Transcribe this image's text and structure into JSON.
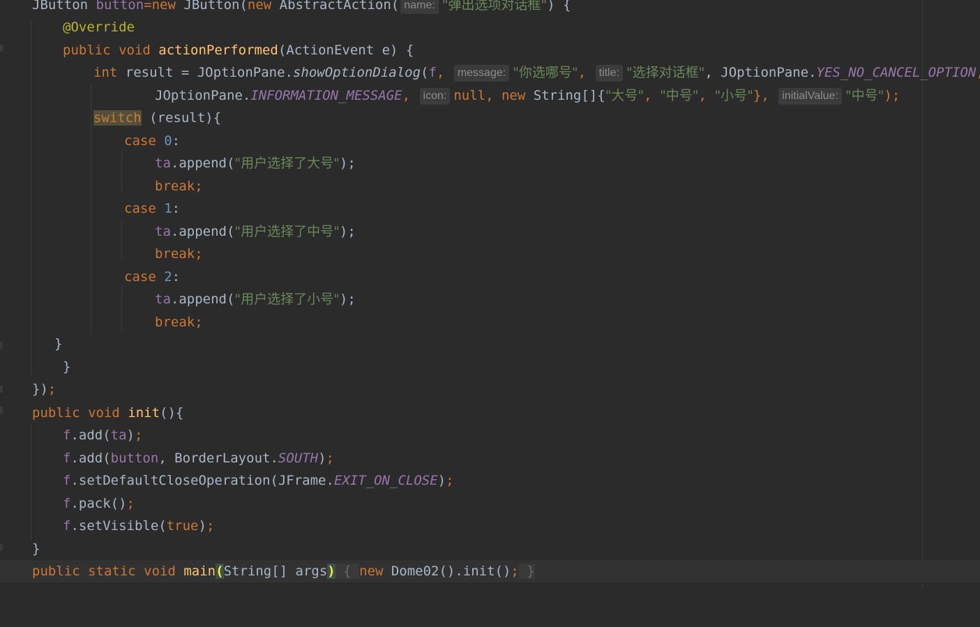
{
  "lines": [
    {
      "t1": "JButton ",
      "t2": "button",
      "t3": "=",
      "t4": "new ",
      "t5": "JButton(",
      "t6": "new ",
      "t7": "AbstractAction(",
      "hint": "name:",
      "str": "\"弹出选项对话框\"",
      "t8": ") {"
    },
    {
      "ann": "@Override"
    },
    {
      "kw": "public void ",
      "meth": "actionPerformed",
      "rest": "(ActionEvent e) {"
    },
    {
      "kw": "int ",
      "a": "result = JOptionPane.",
      "call": "showOptionDialog",
      "b": "(",
      "fld": "f",
      ", ": ", ",
      "hint1": "message:",
      "str1": "\"你选哪号\"",
      "c1": ", ",
      "hint2": "title:",
      "str2": "\"选择对话框\"",
      "c2": ", JOptionPane.",
      "ital": "YES_NO_CANCEL_OPTION",
      "c3": ","
    },
    {
      "a": "JOptionPane.",
      "ital": "INFORMATION_MESSAGE",
      "c1": ", ",
      "hint1": "icon:",
      "kw1": "null",
      "c2": ", ",
      "kw2": "new ",
      "b": "String[]{",
      "s1": "\"大号\"",
      "c3": ", ",
      "s2": "\"中号\"",
      "c4": ", ",
      "s3": "\"小号\"",
      "c5": "}, ",
      "hint2": "initialValue:",
      "s4": "\"中号\"",
      "end": ");"
    },
    {
      "kw": "switch",
      "rest": " (result){"
    },
    {
      "kw": "case ",
      "num": "0",
      "rest": ":"
    },
    {
      "fld": "ta",
      "a": ".append(",
      "str": "\"用户选择了大号\"",
      "b": ");"
    },
    {
      "kw": "break;"
    },
    {
      "kw": "case ",
      "num": "1",
      "rest": ":"
    },
    {
      "fld": "ta",
      "a": ".append(",
      "str": "\"用户选择了中号\"",
      "b": ");"
    },
    {
      "kw": "break;"
    },
    {
      "kw": "case ",
      "num": "2",
      "rest": ":"
    },
    {
      "fld": "ta",
      "a": ".append(",
      "str": "\"用户选择了小号\"",
      "b": ");"
    },
    {
      "kw": "break;"
    },
    {
      "a": "}"
    },
    {
      "a": "}"
    },
    {
      "a": "})",
      "kw": ";"
    },
    {
      "kw": "public void ",
      "meth": "init",
      "rest": "(){"
    },
    {
      "fld": "f",
      "a": ".add(",
      "fld2": "ta",
      "b": ")",
      "kw": ";"
    },
    {
      "fld": "f",
      "a": ".add(",
      "fld2": "button",
      "c": ", BorderLayout.",
      "ital": "SOUTH",
      "b": ")",
      "kw": ";"
    },
    {
      "fld": "f",
      "a": ".setDefaultCloseOperation(JFrame.",
      "ital": "EXIT_ON_CLOSE",
      "b": ")",
      "kw": ";"
    },
    {
      "fld": "f",
      "a": ".pack()",
      "kw": ";"
    },
    {
      "fld": "f",
      "a": ".setVisible(",
      "kw1": "true",
      "b": ")",
      "kw": ";"
    },
    {
      "a": "}"
    },
    {
      "kw1": "public static void ",
      "meth": "main",
      "p1": "(",
      "args": "String[] args",
      "p2": ")",
      "f1": " { ",
      "kw2": "new ",
      "a": "Dome02().init()",
      "semi": ";",
      "f2": " }"
    }
  ]
}
